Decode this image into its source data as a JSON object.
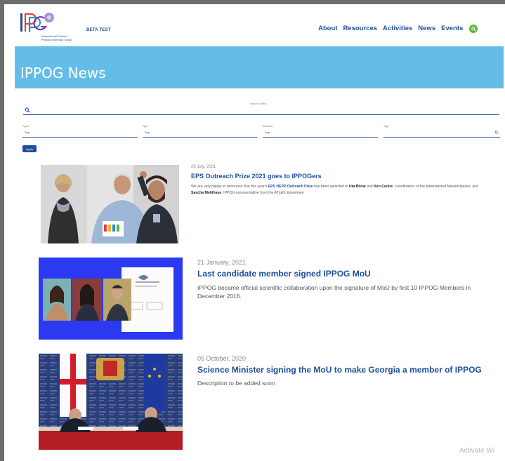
{
  "header": {
    "logo_caption": "International Particle Physics Outreach Group",
    "beta_label": "BETA TEST",
    "nav": [
      "About",
      "Resources",
      "Activities",
      "News",
      "Events"
    ]
  },
  "hero": {
    "title": "IPPOG News"
  },
  "search": {
    "label": "Search Fulltext"
  },
  "filters": [
    {
      "label": "Types",
      "value": "- Any -"
    },
    {
      "label": "Type",
      "value": "- Any -"
    },
    {
      "label": "Audience",
      "value": "- Any -"
    },
    {
      "label": "Tags",
      "value": ""
    }
  ],
  "apply_label": "Apply",
  "news": [
    {
      "date": "26 July, 2021",
      "title": "EPS Outreach Prize 2021 goes to IPPOGers",
      "desc_parts": [
        {
          "t": "We are very happy to announce that this year's ",
          "s": ""
        },
        {
          "t": "EPS HEPP Outreach Prize",
          "s": "hl"
        },
        {
          "t": " has been awarded  to ",
          "s": ""
        },
        {
          "t": "Uta Bilow",
          "s": "b"
        },
        {
          "t": " and ",
          "s": ""
        },
        {
          "t": "Ken Cecire",
          "s": "b"
        },
        {
          "t": ", coordinators of the International Masterclasses, and ",
          "s": ""
        },
        {
          "t": "Sascha Mehlhase",
          "s": "b"
        },
        {
          "t": ", IPPOG representative from the ATLAS Experimen",
          "s": ""
        }
      ]
    },
    {
      "date": "21 January, 2021",
      "title": "Last candidate member signed IPPOG MoU",
      "desc": "IPPOG became official scientific collaboration upon the signature of MoU by first 10 IPPOG Members in December 2016."
    },
    {
      "date": "05 October, 2020",
      "title": "Science Minister signing the MoU to make Georgia a member of IPPOG",
      "desc": "Description to be added soon"
    }
  ],
  "watermark": "Activate Wi"
}
